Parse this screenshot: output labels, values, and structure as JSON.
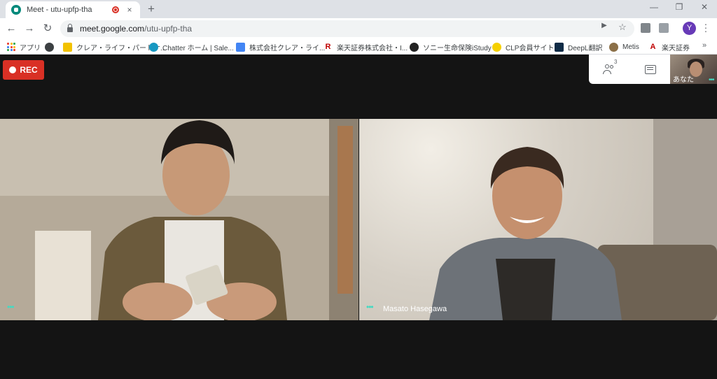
{
  "browser": {
    "tab_title": "Meet - utu-upfp-tha",
    "tab_close": "×",
    "new_tab": "+",
    "window_controls": [
      "—",
      "❐",
      "✕"
    ],
    "url_host": "meet.google.com",
    "url_path": "/utu-upfp-tha",
    "profile_initial": "Y",
    "nav": {
      "back": "←",
      "forward": "→",
      "reload": "↻"
    },
    "omnibox_icons": {
      "camera": "▶",
      "star": "☆"
    },
    "bookmarks_overflow": "»"
  },
  "bookmarks": [
    {
      "label": "アプリ",
      "icon": "apps-icon"
    },
    {
      "label": "",
      "icon": "globe-icon"
    },
    {
      "label": "クレア・ライフ・パートナ...",
      "icon": "crea-icon",
      "color": "#f2c200"
    },
    {
      "label": "Chatter ホーム | Sale...",
      "icon": "salesforce-icon",
      "color": "#1798c1"
    },
    {
      "label": "株式会社クレア・ライ...",
      "icon": "calendar-icon",
      "color": "#4285f4"
    },
    {
      "label": "楽天証券株式会社・I...",
      "icon": "rakuten-icon",
      "color": "#bf0000"
    },
    {
      "label": "ソニー生命保険iStudy",
      "icon": "sony-icon",
      "color": "#222222"
    },
    {
      "label": "CLP会員サイト",
      "icon": "clp-icon",
      "color": "#f5d000"
    },
    {
      "label": "DeepL翻訳",
      "icon": "deepl-icon",
      "color": "#0f2b46"
    },
    {
      "label": "Metis",
      "icon": "metis-icon",
      "color": "#8b6f47"
    },
    {
      "label": "楽天証券",
      "icon": "rakuten-sec-icon",
      "color": "#bf0000"
    }
  ],
  "meet": {
    "rec_label": "REC",
    "participant_count": "3",
    "self_label": "あなた",
    "dots": "•••",
    "tiles": [
      {
        "name": ""
      },
      {
        "name": "Masato Hasegawa"
      }
    ]
  }
}
